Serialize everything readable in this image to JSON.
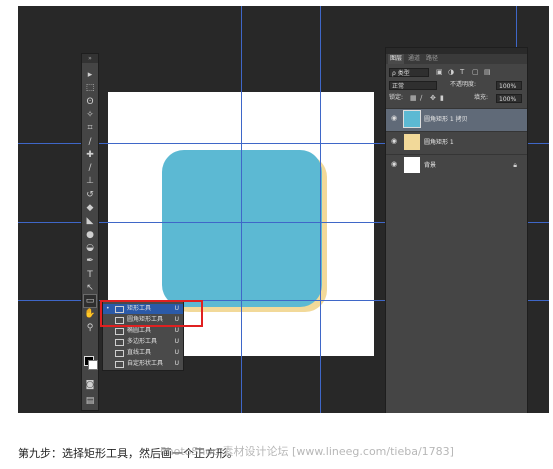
{
  "toolbar": {
    "header": "»",
    "tools": [
      {
        "name": "move-icon",
        "glyph": "▸"
      },
      {
        "name": "marquee-icon",
        "glyph": "⬚"
      },
      {
        "name": "lasso-icon",
        "glyph": "ʘ"
      },
      {
        "name": "magic-wand-icon",
        "glyph": "✧"
      },
      {
        "name": "crop-icon",
        "glyph": "⌗"
      },
      {
        "name": "eyedropper-icon",
        "glyph": "∕"
      },
      {
        "name": "healing-brush-icon",
        "glyph": "✚"
      },
      {
        "name": "brush-icon",
        "glyph": "∕"
      },
      {
        "name": "clone-stamp-icon",
        "glyph": "⊥"
      },
      {
        "name": "history-brush-icon",
        "glyph": "↺"
      },
      {
        "name": "eraser-icon",
        "glyph": "◆"
      },
      {
        "name": "paint-bucket-icon",
        "glyph": "◣"
      },
      {
        "name": "blur-icon",
        "glyph": "●"
      },
      {
        "name": "dodge-icon",
        "glyph": "◒"
      },
      {
        "name": "pen-icon",
        "glyph": "✒"
      },
      {
        "name": "type-icon",
        "glyph": "T"
      },
      {
        "name": "path-selection-icon",
        "glyph": "↖"
      },
      {
        "name": "rectangle-tool-icon",
        "glyph": "▭"
      },
      {
        "name": "hand-icon",
        "glyph": "✋"
      },
      {
        "name": "zoom-icon",
        "glyph": "⚲"
      }
    ],
    "quick_mask": "◙",
    "screen_mode": "▤"
  },
  "flyout": {
    "items": [
      {
        "label": "矩形工具",
        "key": "U",
        "bullet": "•"
      },
      {
        "label": "圆角矩形工具",
        "key": "U",
        "bullet": ""
      },
      {
        "label": "椭圆工具",
        "key": "U",
        "bullet": ""
      },
      {
        "label": "多边形工具",
        "key": "U",
        "bullet": ""
      },
      {
        "label": "直线工具",
        "key": "U",
        "bullet": ""
      },
      {
        "label": "自定形状工具",
        "key": "U",
        "bullet": ""
      }
    ]
  },
  "layers_panel": {
    "tabs": [
      "图层",
      "通道",
      "路径"
    ],
    "filter_label": "ρ 类型",
    "blend_mode": "正常",
    "opacity_label": "不透明度:",
    "opacity_value": "100%",
    "lock_label": "锁定:",
    "fill_label": "填充:",
    "fill_value": "100%",
    "layers": [
      {
        "name": "圆角矩形 1 拷贝",
        "selected": true,
        "locked": false
      },
      {
        "name": "圆角矩形 1",
        "selected": false,
        "locked": false
      },
      {
        "name": "背景",
        "selected": false,
        "locked": true
      }
    ]
  },
  "canvas": {
    "shape_color": "#5cb9d3",
    "shadow_color": "#f2d999",
    "guide_color": "#3f67c8"
  },
  "caption": "第九步：选择矩形工具，然后画一个正方形。",
  "watermark": "PhotoShop 素材设计论坛 [www.lineeg.com/tieba/1783]"
}
